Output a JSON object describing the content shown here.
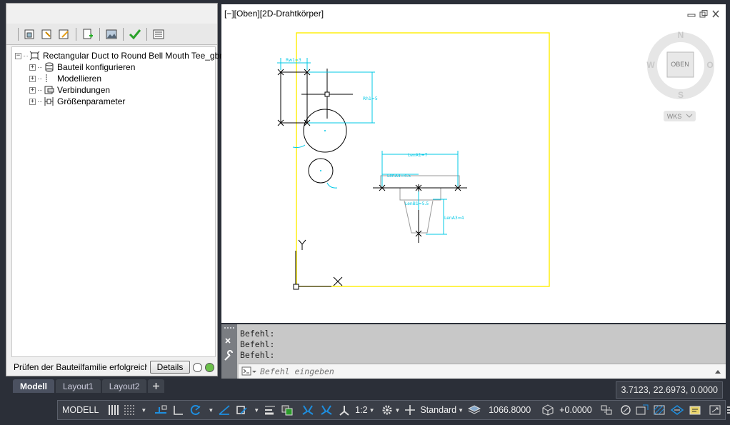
{
  "palette": {
    "tree": {
      "root": "Rectangular Duct to Round Bell Mouth Tee_gbm",
      "children": [
        "Bauteil konfigurieren",
        "Modellieren",
        "Verbindungen",
        "Größenparameter"
      ]
    },
    "status_text": "Prüfen der Bauteilfamilie erfolgreich",
    "details_label": "Details"
  },
  "viewport": {
    "label": "[−][Oben][2D-Drahtkörper]",
    "viewcube": {
      "north": "N",
      "south": "S",
      "west": "W",
      "east": "O",
      "face": "OBEN",
      "ucs": "WKS"
    },
    "dimensions": {
      "rw": "Rw1=3",
      "rh": "Rh1=5",
      "len_a1": "LenA1=7",
      "len_a4": "LenA4=4.5",
      "len_b": "LenB1=5.5",
      "len_a3": "LenA3=4",
      "ucs_x": "X",
      "ucs_y": "Y"
    }
  },
  "command": {
    "history": [
      "Befehl:",
      "Befehl:",
      "Befehl:"
    ],
    "placeholder": "Befehl eingeben"
  },
  "tabs": [
    "Modell",
    "Layout1",
    "Layout2"
  ],
  "coordinates": "3.7123, 22.6973, 0.0000",
  "statusbar": {
    "model": "MODELL",
    "scale": "1:2",
    "style": "Standard",
    "elevation": "1066.8000",
    "offset": "+0.0000"
  },
  "colors": {
    "accent": "#1e8fe0",
    "boundary": "#ffee00",
    "dimension": "#00c8e6",
    "check": "#2aa22a"
  }
}
